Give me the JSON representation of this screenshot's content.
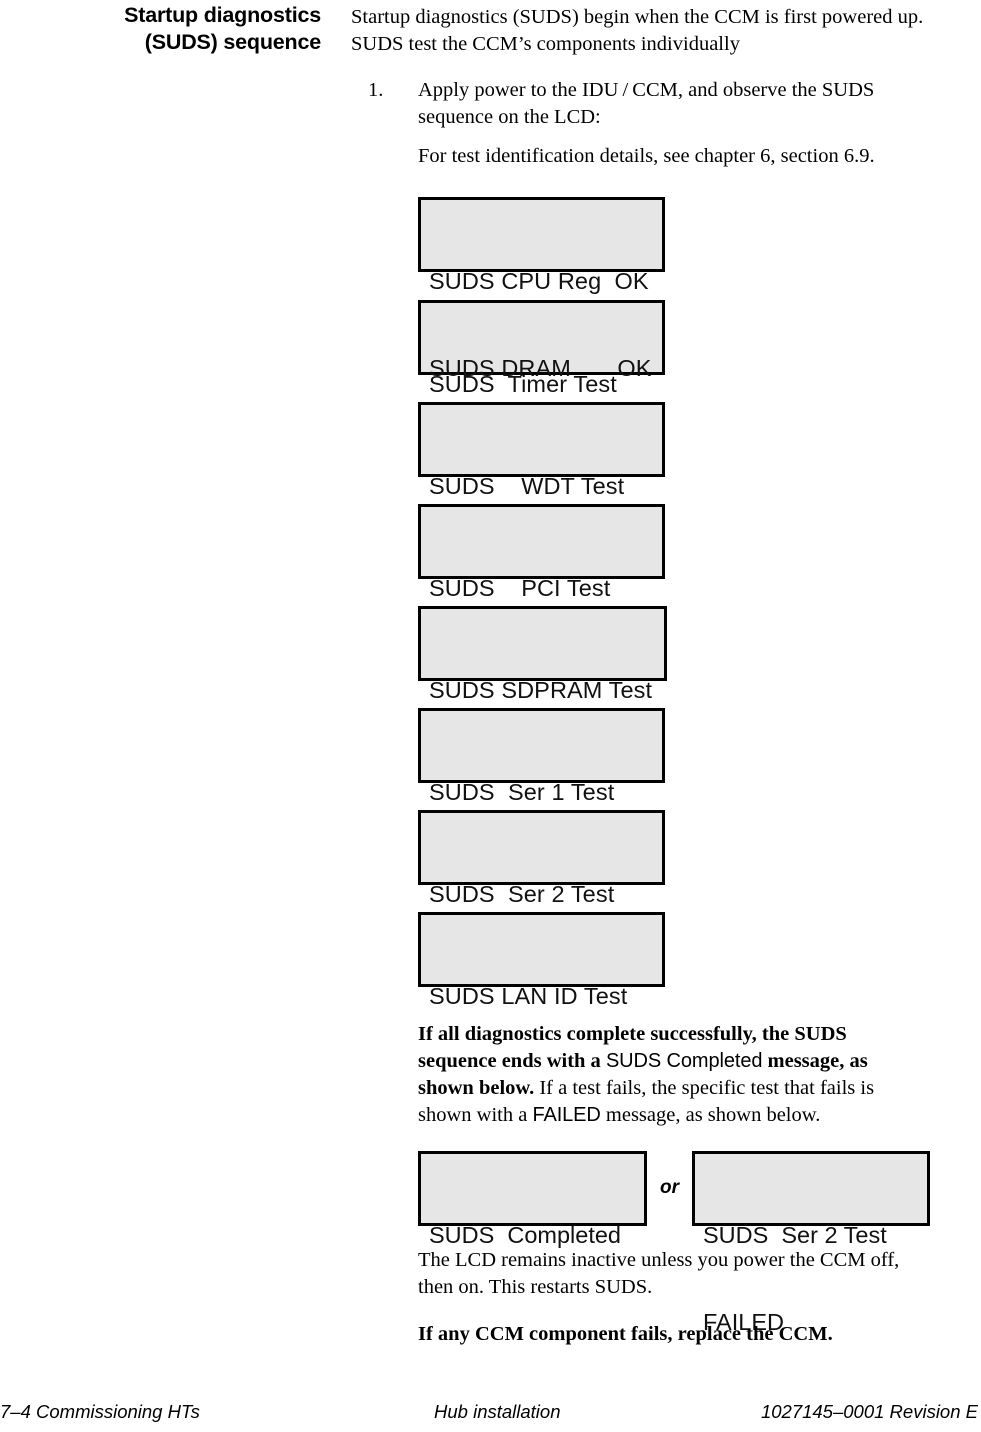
{
  "heading": {
    "line1": "Startup diagnostics",
    "line2": "(SUDS) sequence"
  },
  "intro": "Startup diagnostics (SUDS) begin when the CCM is first powered up. SUDS test the CCM’s components individually",
  "step": {
    "number": "1.",
    "text": "Apply power to the IDU / CCM, and observe the SUDS sequence on the LCD:",
    "subtext": "For test identification details, see chapter 6, section 6.9."
  },
  "lcd_boxes": [
    {
      "name": "suds-cpu-reg-dram",
      "line1": "SUDS CPU Reg  OK",
      "line2": "SUDS DRAM       OK"
    },
    {
      "name": "suds-timer-test",
      "line1": "SUDS  Timer Test",
      "line2": ""
    },
    {
      "name": "suds-wdt-test",
      "line1": "SUDS    WDT Test",
      "line2": ""
    },
    {
      "name": "suds-pci-test",
      "line1": "SUDS    PCI Test",
      "line2": ""
    },
    {
      "name": "suds-sdpram-test",
      "line1": "SUDS SDPRAM Test",
      "line2": ""
    },
    {
      "name": "suds-ser1-test",
      "line1": "SUDS  Ser 1 Test",
      "line2": ""
    },
    {
      "name": "suds-ser2-test",
      "line1": "SUDS  Ser 2 Test",
      "line2": ""
    },
    {
      "name": "suds-lan-id-test",
      "line1": "SUDS LAN ID Test",
      "line2": ""
    }
  ],
  "explanation": {
    "bold1": "If all diagnostics complete successfully, the SUDS sequence ends with a ",
    "lcd1": "SUDS Completed",
    "bold2": " message, as shown below.",
    "normal1": " If a test fails, the specific test that fails is shown with a ",
    "lcd2": "FAILED",
    "normal2": " message, as shown below."
  },
  "result_row": {
    "success_line1": "SUDS  Completed",
    "success_line2": "",
    "or_label": "or",
    "failure_line1": "SUDS  Ser 2 Test",
    "failure_line2": "FAILED"
  },
  "tail": {
    "paragraph": "The LCD remains inactive unless you power the CCM off, then on. This restarts SUDS.",
    "bold_note": "If any CCM component fails, replace the CCM."
  },
  "footer": {
    "left": "7–4  Commissioning HTs",
    "center": "Hub installation",
    "right": "1027145–0001   Revision E"
  },
  "colors": {
    "lcd_fill": "#e6e6e6",
    "lcd_border": "#000000",
    "text": "#000000",
    "page_background": "#ffffff"
  }
}
